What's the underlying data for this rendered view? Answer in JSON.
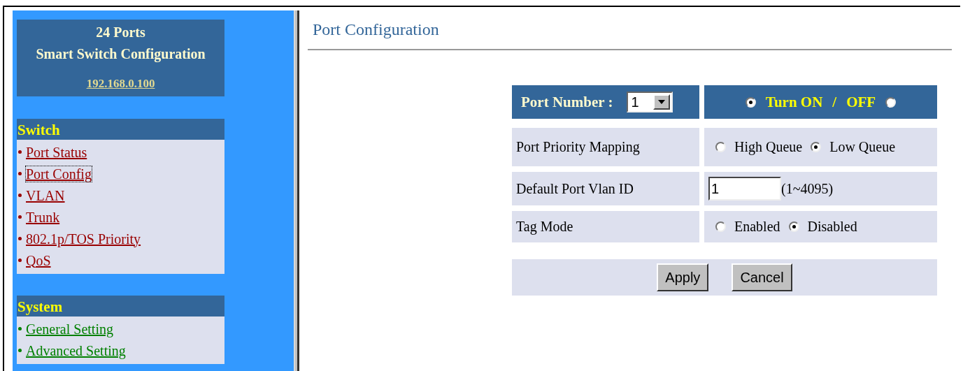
{
  "sidebar": {
    "header": {
      "title_lines": [
        "24 Ports",
        "Smart Switch Configuration"
      ],
      "address": "192.168.0.100"
    },
    "sections": [
      {
        "title": "Switch",
        "color": "#990000",
        "items": [
          {
            "label": "Port Status",
            "selected": false
          },
          {
            "label": "Port Config",
            "selected": true
          },
          {
            "label": "VLAN",
            "selected": false
          },
          {
            "label": "Trunk",
            "selected": false
          },
          {
            "label": "802.1p/TOS Priority",
            "selected": false
          },
          {
            "label": "QoS",
            "selected": false
          }
        ]
      },
      {
        "title": "System",
        "color": "#008000",
        "items": [
          {
            "label": "General Setting",
            "selected": false
          },
          {
            "label": "Advanced Setting",
            "selected": false
          }
        ]
      }
    ]
  },
  "page_title": "Port Configuration",
  "form": {
    "port_number": {
      "label": "Port Number :",
      "value": "1"
    },
    "power": {
      "options": [
        {
          "label": "Turn ON",
          "selected": true
        },
        {
          "label": "OFF",
          "selected": false
        }
      ],
      "separator": "/"
    },
    "rows": [
      {
        "kind": "radio",
        "label": "Port Priority Mapping",
        "options": [
          {
            "label": "High Queue",
            "selected": false
          },
          {
            "label": "Low Queue",
            "selected": true
          }
        ]
      },
      {
        "kind": "text",
        "label": "Default Port Vlan ID",
        "value": "1",
        "hint": "(1~4095)"
      },
      {
        "kind": "radio",
        "label": "Tag Mode",
        "options": [
          {
            "label": "Enabled",
            "selected": false
          },
          {
            "label": "Disabled",
            "selected": true
          }
        ]
      }
    ],
    "buttons": [
      "Apply",
      "Cancel"
    ]
  }
}
